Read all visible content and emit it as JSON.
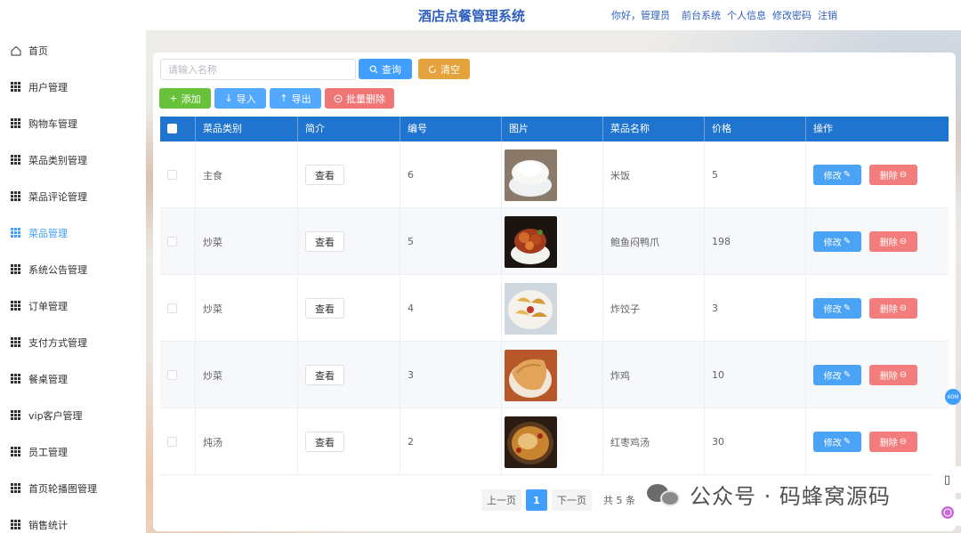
{
  "header": {
    "title": "酒店点餐管理系统",
    "greeting": "你好，管理员",
    "links": [
      "前台系统",
      "个人信息",
      "修改密码",
      "注销"
    ]
  },
  "sidebar": {
    "items": [
      {
        "label": "首页",
        "icon": "home-icon",
        "active": false
      },
      {
        "label": "用户管理",
        "icon": "grid-icon",
        "active": false
      },
      {
        "label": "购物车管理",
        "icon": "grid-icon",
        "active": false
      },
      {
        "label": "菜品类别管理",
        "icon": "grid-icon",
        "active": false
      },
      {
        "label": "菜品评论管理",
        "icon": "grid-icon",
        "active": false
      },
      {
        "label": "菜品管理",
        "icon": "grid-icon",
        "active": true
      },
      {
        "label": "系统公告管理",
        "icon": "grid-icon",
        "active": false
      },
      {
        "label": "订单管理",
        "icon": "grid-icon",
        "active": false
      },
      {
        "label": "支付方式管理",
        "icon": "grid-icon",
        "active": false
      },
      {
        "label": "餐桌管理",
        "icon": "grid-icon",
        "active": false
      },
      {
        "label": "vip客户管理",
        "icon": "grid-icon",
        "active": false
      },
      {
        "label": "员工管理",
        "icon": "grid-icon",
        "active": false
      },
      {
        "label": "首页轮播图管理",
        "icon": "grid-icon",
        "active": false
      },
      {
        "label": "销售统计",
        "icon": "grid-icon",
        "active": false
      }
    ]
  },
  "toolbar": {
    "search_placeholder": "请输入名称",
    "query_label": "查询",
    "clear_label": "清空",
    "add_label": "添加",
    "import_label": "导入",
    "export_label": "导出",
    "batch_delete_label": "批量删除"
  },
  "table": {
    "columns": [
      "菜品类别",
      "简介",
      "编号",
      "图片",
      "菜品名称",
      "价格",
      "操作"
    ],
    "view_label": "查看",
    "edit_label": "修改",
    "delete_label": "删除",
    "rows": [
      {
        "category": "主食",
        "id": "6",
        "name": "米饭",
        "price": "5",
        "image": "rice"
      },
      {
        "category": "炒菜",
        "id": "5",
        "name": "鲍鱼闷鸭爪",
        "price": "198",
        "image": "abalone"
      },
      {
        "category": "炒菜",
        "id": "4",
        "name": "炸饺子",
        "price": "3",
        "image": "dumplings"
      },
      {
        "category": "炒菜",
        "id": "3",
        "name": "炸鸡",
        "price": "10",
        "image": "chicken"
      },
      {
        "category": "炖汤",
        "id": "2",
        "name": "红枣鸡汤",
        "price": "30",
        "image": "soup"
      }
    ]
  },
  "pagination": {
    "prev_label": "上一页",
    "current_page": "1",
    "next_label": "下一页",
    "total_label": "共 5 条"
  },
  "watermark": {
    "text": "公众号 · 码蜂窝源码"
  },
  "floating": {
    "badge": "60M"
  },
  "colors": {
    "primary": "#409eff",
    "table_header": "#1f74cf",
    "title": "#2f5fbd",
    "warning": "#e6a23c",
    "success": "#67c23a",
    "danger": "#f07676"
  }
}
